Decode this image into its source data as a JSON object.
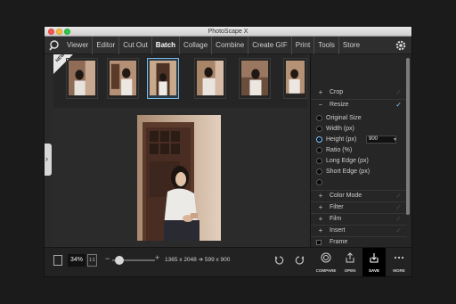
{
  "window": {
    "title": "PhotoScape X"
  },
  "menu": {
    "items": [
      "Viewer",
      "Editor",
      "Cut Out",
      "Batch",
      "Collage",
      "Combine",
      "Create GIF",
      "Print",
      "Tools",
      "Store"
    ],
    "active": "Batch"
  },
  "filmstrip": {
    "badge": "NEW",
    "selected_index": 2,
    "thumb_count": 6
  },
  "panel": {
    "crop_label": "Crop",
    "resize_label": "Resize",
    "resize_options": [
      "Original Size",
      "Width (px)",
      "Height (px)",
      "Ratio (%)",
      "Long Edge (px)",
      "Short Edge (px)"
    ],
    "selected_option": "Height (px)",
    "height_value": "900",
    "color_mode_label": "Color Mode",
    "filter_label": "Filter",
    "film_label": "Film",
    "insert_label": "Insert",
    "frame_label": "Frame"
  },
  "bottom": {
    "zoom": "34%",
    "one_to_one": "1:1",
    "dimensions": "1365 x 2048 ➔ 599 x 900",
    "compare_label": "COMPARE",
    "open_label": "OPEN",
    "save_label": "SAVE",
    "more_label": "MORE"
  },
  "colors": {
    "accent": "#7fc6ff",
    "window_bg": "#2a2a2a",
    "desktop_bg": "#1b1b1b"
  }
}
